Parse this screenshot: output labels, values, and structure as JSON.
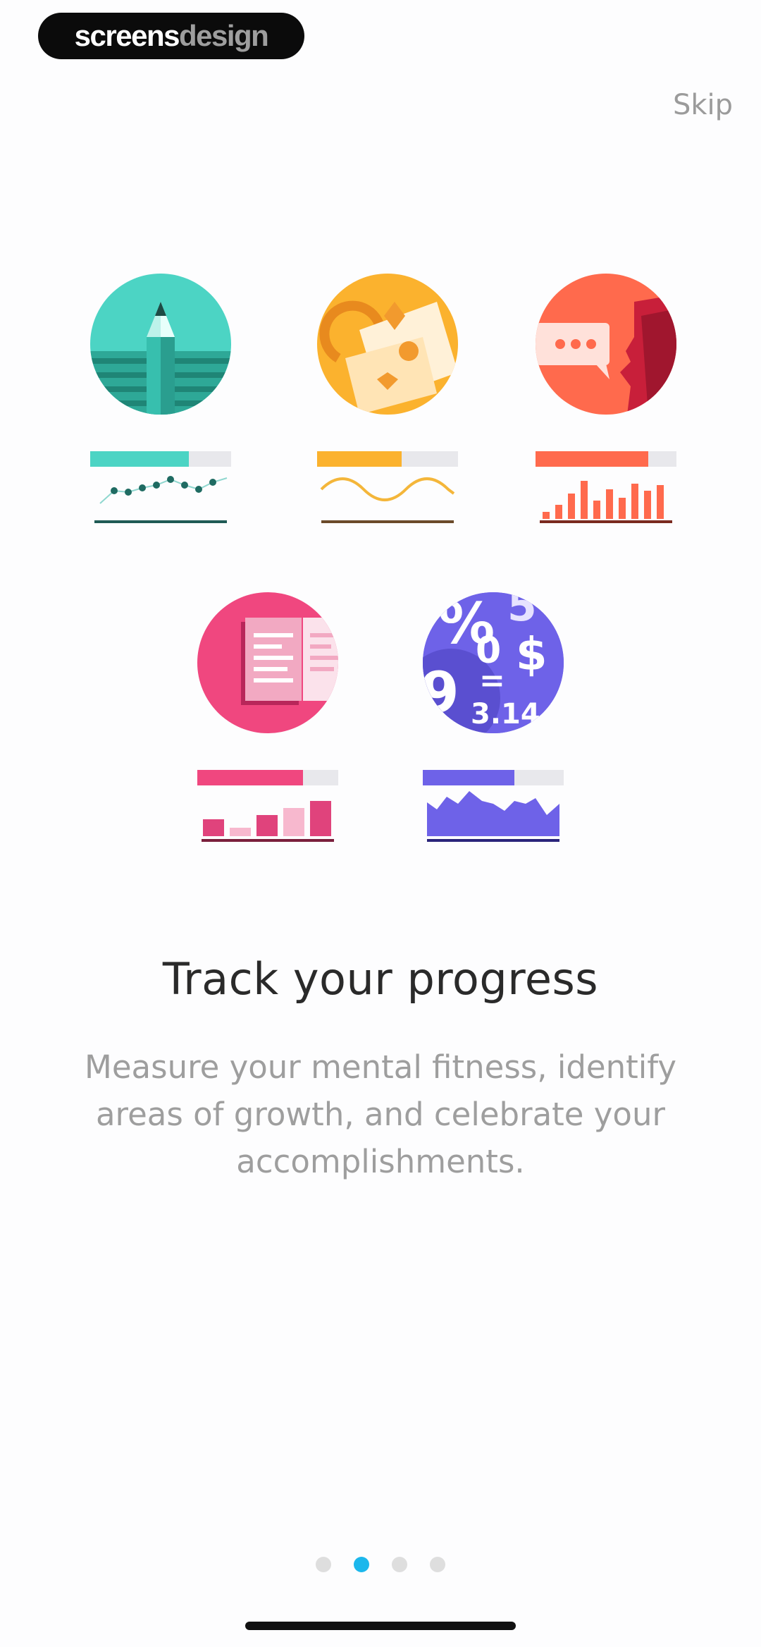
{
  "brand": {
    "part1": "screens",
    "part2": "design"
  },
  "skip_label": "Skip",
  "tiles": [
    {
      "name": "writing",
      "icon": "pencil-icon",
      "color": "#4CD4C4",
      "progress": 0.7
    },
    {
      "name": "memory",
      "icon": "cards-icon",
      "color": "#FBB22E",
      "progress": 0.6
    },
    {
      "name": "speaking",
      "icon": "speech-bubble-icon",
      "color": "#FF6A4D",
      "progress": 0.8
    },
    {
      "name": "reading",
      "icon": "book-icon",
      "color": "#F0477F",
      "progress": 0.75
    },
    {
      "name": "math",
      "icon": "numbers-icon",
      "color": "#6E62E8",
      "progress": 0.65
    }
  ],
  "math_icon_glyphs": [
    "%",
    "5",
    "0",
    "$",
    "=",
    "9",
    "3.14"
  ],
  "headline": "Track your progress",
  "body": "Measure your mental fitness, identify areas of growth, and celebrate your accomplishments.",
  "pager": {
    "count": 4,
    "active_index": 1
  }
}
